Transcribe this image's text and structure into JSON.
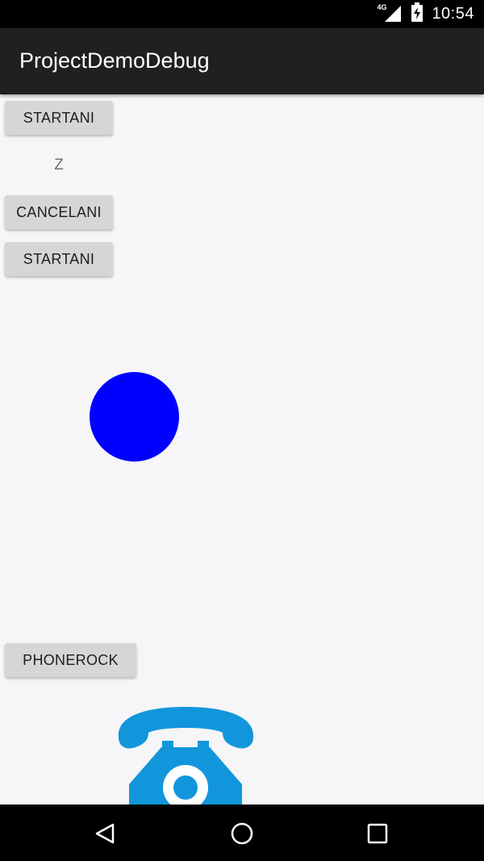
{
  "status_bar": {
    "network": "4G",
    "time": "10:54",
    "icons": [
      "signal-icon",
      "battery-charging-icon"
    ]
  },
  "app_bar": {
    "title": "ProjectDemoDebug"
  },
  "buttons": {
    "start_ani_1": "STARTANI",
    "cancel_ani": "CANCELANI",
    "start_ani_2": "STARTANI",
    "phone_rock": "PHONEROCK"
  },
  "labels": {
    "z_label": "Z"
  },
  "canvas": {
    "ball_color": "#0000ff",
    "phone_icon": "phone-icon",
    "phone_color": "#1296db"
  },
  "nav_bar": {
    "icons": [
      "back-icon",
      "home-icon",
      "recents-icon"
    ]
  }
}
